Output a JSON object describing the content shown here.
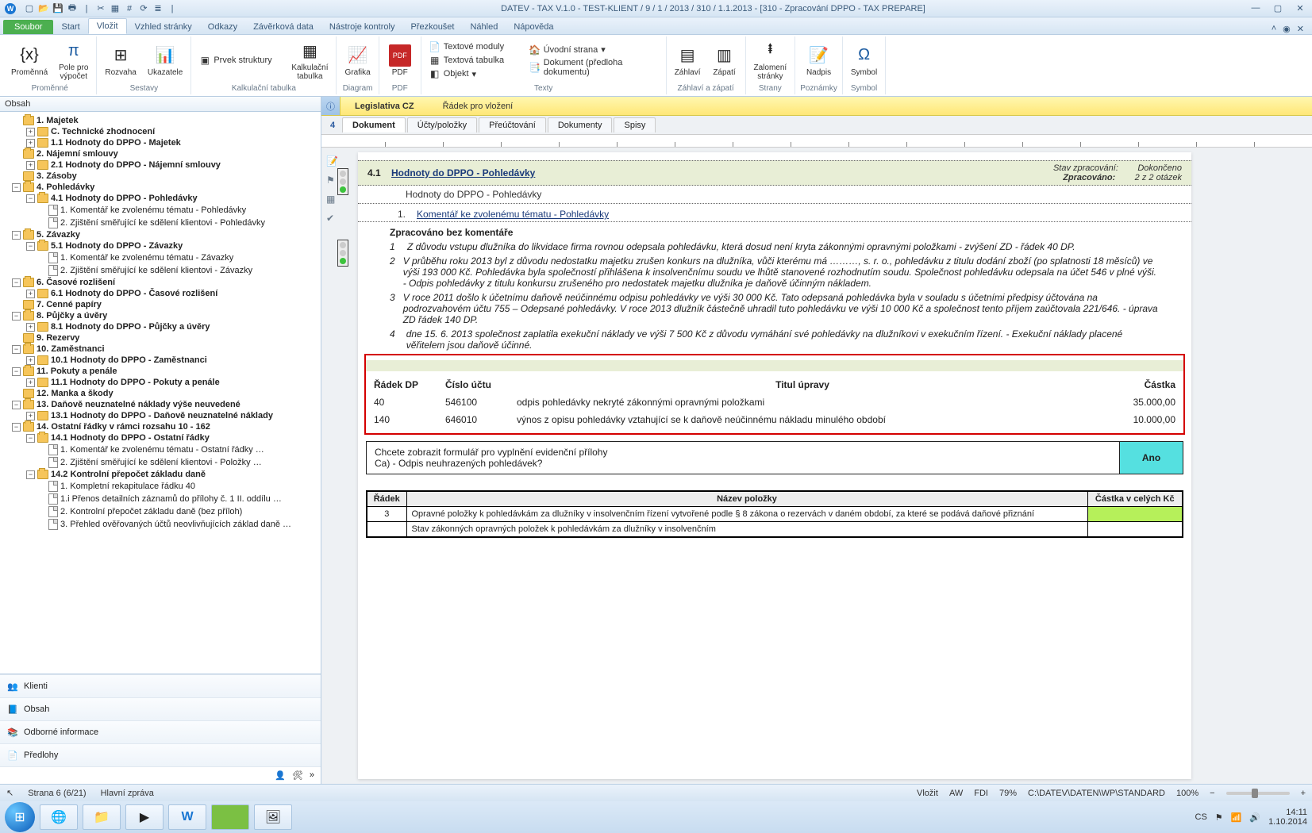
{
  "title": "DATEV - TAX V.1.0 - TEST-KLIENT / 9 / 1 / 2013 / 310 / 1.1.2013  - [310 - Zpracování DPPO - TAX PREPARE]",
  "ribbonTabs": {
    "file": "Soubor",
    "start": "Start",
    "vlozit": "Vložit",
    "vzhled": "Vzhled stránky",
    "odkazy": "Odkazy",
    "zaverk": "Závěrková data",
    "nastroje": "Nástroje kontroly",
    "prezk": "Přezkoušet",
    "nahled": "Náhled",
    "napoveda": "Nápověda"
  },
  "ribbon": {
    "promenna": "Proměnná",
    "polepro": "Pole pro\nvýpočet",
    "g1": "Proměnné",
    "rozvaha": "Rozvaha",
    "ukazatele": "Ukazatele",
    "g2": "Sestavy",
    "prvek": "Prvek struktury",
    "kalkul": "Kalkulační\ntabulka",
    "g3": "Kalkulační tabulka",
    "grafika": "Grafika",
    "g4": "Diagram",
    "pdf": "PDF",
    "g5": "PDF",
    "textmod": "Textové moduly",
    "texttab": "Textová tabulka",
    "objekt": "Objekt",
    "uvod": "Úvodní strana",
    "dokpred": "Dokument (předloha dokumentu)",
    "g6": "Texty",
    "zahlavi": "Záhlaví",
    "zapati": "Zápatí",
    "g7": "Záhlaví a zápatí",
    "zalom": "Zalomení\nstránky",
    "g8": "Strany",
    "nadpis": "Nadpis",
    "g9": "Poznámky",
    "symbol": "Symbol",
    "g10": "Symbol"
  },
  "leftHeader": "Obsah",
  "tree": {
    "n1": "1. Majetek",
    "n2": "C. Technické zhodnocení",
    "n3": "1.1 Hodnoty do DPPO - Majetek",
    "n4": "2. Nájemní smlouvy",
    "n5": "2.1 Hodnoty do DPPO - Nájemní smlouvy",
    "n6": "3. Zásoby",
    "n7": "4. Pohledávky",
    "n8": "4.1 Hodnoty do DPPO - Pohledávky",
    "n8a": "1. Komentář ke zvolenému tématu - Pohledávky",
    "n8b": "2. Zjištění směřující ke sdělení klientovi - Pohledávky",
    "n9": "5. Závazky",
    "n10": "5.1 Hodnoty do DPPO - Závazky",
    "n10a": "1. Komentář ke zvolenému tématu - Závazky",
    "n10b": "2. Zjištění směřující ke sdělení klientovi - Závazky",
    "n11": "6. Časové rozlišení",
    "n12": "6.1 Hodnoty do DPPO - Časové rozlišení",
    "n13": "7. Cenné papíry",
    "n14": "8. Půjčky a úvěry",
    "n15": "8.1 Hodnoty do DPPO - Půjčky a úvěry",
    "n16": "9. Rezervy",
    "n17": "10. Zaměstnanci",
    "n18": "10.1 Hodnoty do DPPO - Zaměstnanci",
    "n19": "11. Pokuty a penále",
    "n20": "11.1 Hodnoty do DPPO - Pokuty a penále",
    "n21": "12. Manka a škody",
    "n22": "13. Daňově neuznatelné náklady výše neuvedené",
    "n23": "13.1 Hodnoty do DPPO - Daňově neuznatelné náklady",
    "n24": "14. Ostatní řádky v rámci rozsahu 10 - 162",
    "n25": "14.1 Hodnoty do DPPO - Ostatní řádky",
    "n25a": "1. Komentář ke zvolenému tématu - Ostatní řádky …",
    "n25b": "2. Zjištění směřující ke sdělení klientovi - Položky …",
    "n26": "14.2 Kontrolní přepočet základu daně",
    "n26a": "1. Kompletní rekapitulace řádku 40",
    "n26b": "1.i Přenos detailních záznamů do přílohy č. 1 II. oddílu …",
    "n26c": "2. Kontrolní přepočet základu daně (bez příloh)",
    "n26d": "3. Přehled ověřovaných účtů neovlivňujících základ daně …"
  },
  "nav": {
    "klienti": "Klienti",
    "obsah": "Obsah",
    "odborne": "Odborné informace",
    "predlohy": "Předlohy"
  },
  "infobar": {
    "leg": "Legislativa CZ",
    "radek": "Řádek pro vložení"
  },
  "pgnum": "4",
  "docTabs": {
    "dokument": "Dokument",
    "ucty": "Účty/položky",
    "preuc": "Přeúčtování",
    "dokumenty": "Dokumenty",
    "spisy": "Spisy"
  },
  "doc": {
    "secNum": "4.1",
    "secTitle": "Hodnoty do DPPO - Pohledávky",
    "statLabel": "Stav zpracování:",
    "statVal": "Dokončeno",
    "zprLabel": "Zpracováno:",
    "zprVal": "2   z   2   otázek",
    "sub": "Hodnoty do DPPO - Pohledávky",
    "h1n": "1.",
    "h1": "Komentář ke zvolenému tématu - Pohledávky",
    "bez": "Zpracováno bez komentáře",
    "p1": "Z důvodu vstupu dlužníka do likvidace firma rovnou odepsala pohledávku, která dosud není kryta zákonnými opravnými položkami - zvýšení ZD - řádek 40 DP.",
    "p2": "V průběhu roku 2013 byl z důvodu nedostatku majetku zrušen konkurs na dlužníka, vůči kterému má ………, s. r. o., pohledávku z titulu dodání zboží (po splatnosti 18 měsíců) ve výši 193 000 Kč. Pohledávka byla společností přihlášena k insolvenčnímu soudu ve lhůtě stanovené rozhodnutím soudu. Společnost pohledávku odepsala na účet 546 v plné výši. - Odpis pohledávky z titulu konkursu zrušeného pro nedostatek majetku dlužníka je daňově účinným nákladem.",
    "p3": "V roce 2011 došlo k účetnímu daňově neúčinnému odpisu pohledávky ve výši 30 000 Kč. Tato odepsaná pohledávka byla v souladu s účetními předpisy účtována na podrozvahovém účtu 755 – Odepsané pohledávky. V roce 2013 dlužník částečně uhradil tuto pohledávku ve výši 10 000 Kč a společnost tento příjem zaúčtovala 221/646. - úprava ZD řádek 140 DP.",
    "p4": "dne 15. 6. 2013 společnost zaplatila exekuční náklady ve výši 7 500 Kč z důvodu vymáhání své pohledávky na dlužníkovi v exekučním řízení. - Exekuční náklady placené věřitelem jsou daňově účinné.",
    "th1": "Řádek DP",
    "th2": "Číslo účtu",
    "th3": "Titul úpravy",
    "th4": "Částka",
    "r1a": "40",
    "r1b": "546100",
    "r1c": "odpis pohledávky nekryté zákonnými opravnými položkami",
    "r1d": "35.000,00",
    "r2a": "140",
    "r2b": "646010",
    "r2c": "výnos z opisu pohledávky vztahující se k daňově neúčinnému nákladu minulého období",
    "r2d": "10.000,00",
    "prompt1": "Chcete zobrazit formulář pro vyplnění evidenční přílohy",
    "prompt2": "Ca) - Odpis neuhrazených pohledávek?",
    "ano": "Ano",
    "gh1": "Řádek",
    "gh2": "Název položky",
    "gh3": "Částka v celých Kč",
    "g1a": "3",
    "g1b": "Opravné položky k pohledávkám za dlužníky v insolvenčním řízení vytvořené podle § 8 zákona o rezervách v daném období, za které se podává daňové přiznání",
    "g2b": "Stav zákonných opravných položek k pohledávkám za dlužníky v insolvenčním"
  },
  "status": {
    "page": "Strana 6 (6/21)",
    "main": "Hlavní zpráva",
    "vlozit": "Vložit",
    "aw": "AW",
    "fdi": "FDI",
    "zoom": "79%",
    "path": "C:\\DATEV\\DATEN\\WP\\STANDARD",
    "zoom2": "100%"
  },
  "tray": {
    "lang": "CS",
    "time": "14:11",
    "date": "1.10.2014"
  }
}
